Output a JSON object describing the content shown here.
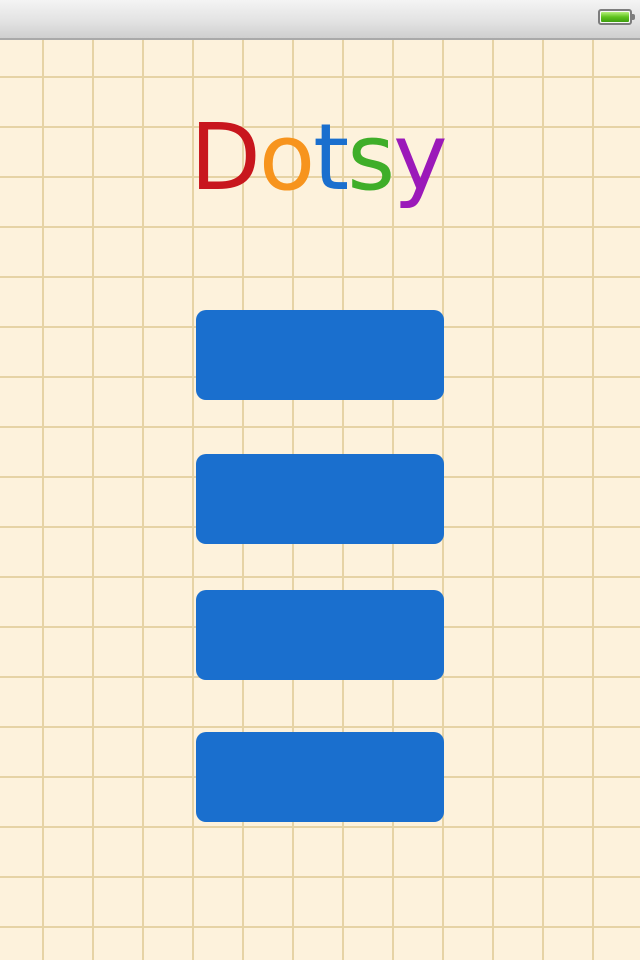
{
  "status_bar": {
    "battery_icon": "battery-full-icon",
    "battery_level": 1.0,
    "battery_color": "#5fc21e"
  },
  "background": {
    "paper_color": "#fdf2dc",
    "grid_line_color": "#e6d3a5"
  },
  "logo": {
    "letters": [
      {
        "char": "D",
        "color": "#c8161d"
      },
      {
        "char": "o",
        "color": "#f7941d"
      },
      {
        "char": "t",
        "color": "#1a6fce"
      },
      {
        "char": "s",
        "color": "#3fae29"
      },
      {
        "char": "y",
        "color": "#9b19b9"
      }
    ]
  },
  "menu": {
    "button_color": "#1a6fce",
    "buttons": [
      {
        "label": ""
      },
      {
        "label": ""
      },
      {
        "label": ""
      },
      {
        "label": ""
      }
    ]
  }
}
